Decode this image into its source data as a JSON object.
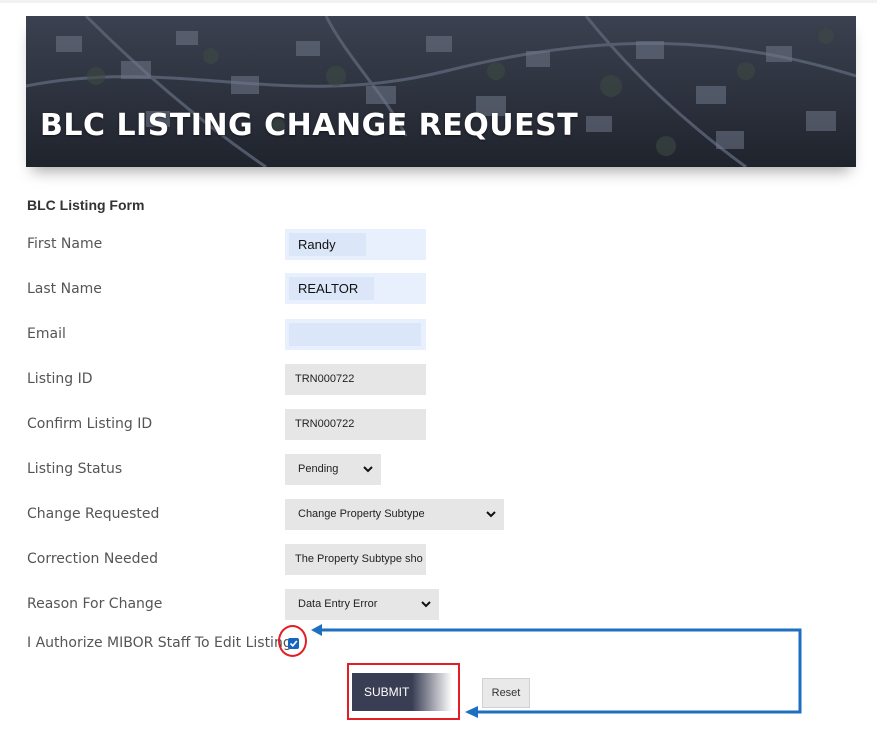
{
  "banner": {
    "title": "BLC LISTING CHANGE REQUEST"
  },
  "form": {
    "heading": "BLC Listing Form",
    "first_name": {
      "label": "First Name",
      "value": "Randy"
    },
    "last_name": {
      "label": "Last Name",
      "value": "REALTOR"
    },
    "email": {
      "label": "Email",
      "value": ""
    },
    "listing_id": {
      "label": "Listing ID",
      "value": "TRN000722"
    },
    "confirm_listing_id": {
      "label": "Confirm Listing ID",
      "value": "TRN000722"
    },
    "listing_status": {
      "label": "Listing Status",
      "selected": "Pending"
    },
    "change_requested": {
      "label": "Change Requested",
      "selected": "Change Property Subtype"
    },
    "correction_needed": {
      "label": "Correction Needed",
      "value": "The Property Subtype sho"
    },
    "reason_for_change": {
      "label": "Reason For Change",
      "selected": "Data Entry Error"
    },
    "authorize": {
      "label": "I Authorize MIBOR Staff To Edit Listing",
      "checked": true
    },
    "submit_label": "SUBMIT",
    "reset_label": "Reset"
  },
  "annotation": {
    "highlight_color": "#e31e24",
    "arrow_color": "#1e6fbf"
  },
  "icons": {
    "select": "chevron-down-icon",
    "checkbox": "checkmark-icon"
  }
}
